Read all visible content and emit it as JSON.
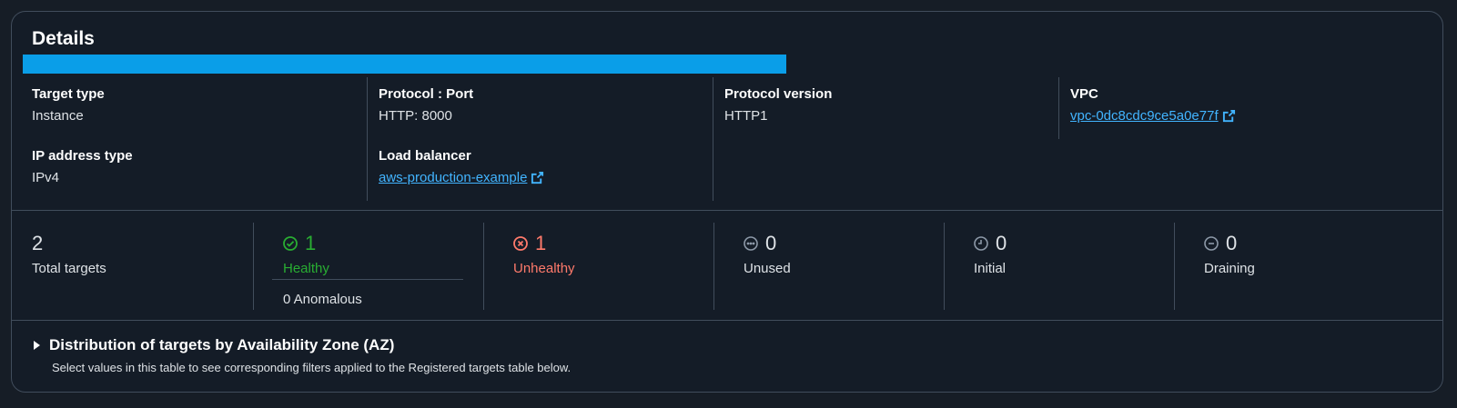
{
  "details": {
    "title": "Details",
    "progress_percent": 53.5,
    "target_type": {
      "label": "Target type",
      "value": "Instance"
    },
    "ip_address_type": {
      "label": "IP address type",
      "value": "IPv4"
    },
    "protocol_port": {
      "label": "Protocol : Port",
      "value": "HTTP: 8000"
    },
    "load_balancer": {
      "label": "Load balancer",
      "value": "aws-production-example"
    },
    "protocol_version": {
      "label": "Protocol version",
      "value": "HTTP1"
    },
    "vpc": {
      "label": "VPC",
      "value": "vpc-0dc8cdc9ce5a0e77f"
    }
  },
  "stats": {
    "total": {
      "value": "2",
      "label": "Total targets"
    },
    "healthy": {
      "value": "1",
      "label": "Healthy",
      "icon": "check-circle-icon"
    },
    "anomalous": "0 Anomalous",
    "unhealthy": {
      "value": "1",
      "label": "Unhealthy",
      "icon": "x-circle-icon"
    },
    "unused": {
      "value": "0",
      "label": "Unused",
      "icon": "ellipsis-circle-icon"
    },
    "initial": {
      "value": "0",
      "label": "Initial",
      "icon": "clock-icon"
    },
    "draining": {
      "value": "0",
      "label": "Draining",
      "icon": "minus-circle-icon"
    }
  },
  "distribution": {
    "title": "Distribution of targets by Availability Zone (AZ)",
    "description": "Select values in this table to see corresponding filters applied to the Registered targets table below."
  },
  "colors": {
    "accent_link": "#42b4ff",
    "healthy": "#29ad32",
    "unhealthy": "#ff7a6b",
    "progress": "#0a9ee8"
  }
}
